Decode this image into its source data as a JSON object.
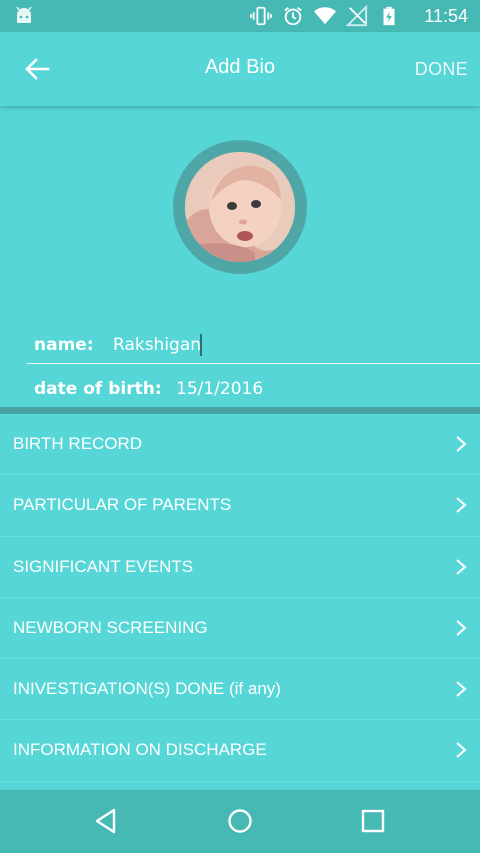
{
  "status_bar": {
    "time": "11:54",
    "icons": [
      "android-icon",
      "vibrate-icon",
      "alarm-icon",
      "wifi-icon",
      "no-signal-icon",
      "battery-charging-icon"
    ]
  },
  "app_bar": {
    "title": "Add Bio",
    "done_label": "DONE",
    "back_icon": "arrow-left-icon"
  },
  "profile": {
    "photo_description": "baby-photo",
    "name_label": "name:",
    "name_value": "Rakshigan",
    "dob_label": "date of birth:",
    "dob_value": "15/1/2016"
  },
  "menu": {
    "items": [
      {
        "label": "BIRTH RECORD"
      },
      {
        "label": "PARTICULAR OF PARENTS"
      },
      {
        "label": "SIGNIFICANT EVENTS"
      },
      {
        "label": "NEWBORN SCREENING"
      },
      {
        "label": "INIVESTIGATION(S) DONE (if any)"
      },
      {
        "label": "INFORMATION ON DISCHARGE"
      }
    ]
  },
  "nav_bar": {
    "buttons": [
      "back-triangle-icon",
      "home-circle-icon",
      "recents-square-icon"
    ]
  },
  "colors": {
    "background": "#56D6D6",
    "status_bar": "#46B9B4",
    "divider": "#49A1A1",
    "avatar_ring": "#4FA6A6"
  }
}
